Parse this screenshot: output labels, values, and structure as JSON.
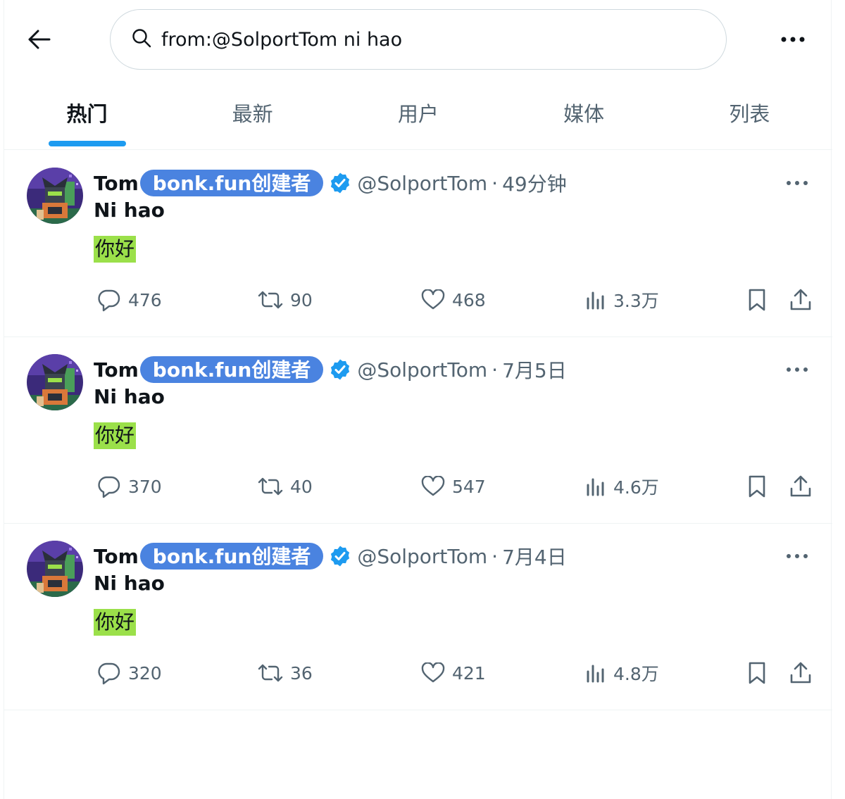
{
  "search": {
    "query": "from:@SolportTom ni hao"
  },
  "tabs": [
    {
      "label": "热门",
      "active": true
    },
    {
      "label": "最新"
    },
    {
      "label": "用户"
    },
    {
      "label": "媒体"
    },
    {
      "label": "列表"
    }
  ],
  "posts": [
    {
      "name": "Tom",
      "badge": "bonk.fun创建者",
      "handle": "@SolportTom",
      "sep": "·",
      "time": "49分钟",
      "title": "Ni hao",
      "body": "你好",
      "replies": "476",
      "reposts": "90",
      "likes": "468",
      "views": "3.3万"
    },
    {
      "name": "Tom",
      "badge": "bonk.fun创建者",
      "handle": "@SolportTom",
      "sep": "·",
      "time": "7月5日",
      "title": "Ni hao",
      "body": "你好",
      "replies": "370",
      "reposts": "40",
      "likes": "547",
      "views": "4.6万"
    },
    {
      "name": "Tom",
      "badge": "bonk.fun创建者",
      "handle": "@SolportTom",
      "sep": "·",
      "time": "7月4日",
      "title": "Ni hao",
      "body": "你好",
      "replies": "320",
      "reposts": "36",
      "likes": "421",
      "views": "4.8万"
    }
  ],
  "colors": {
    "accent": "#1d9bf0",
    "badge": "#4a83e0",
    "highlight": "#9be04a",
    "secondary_text": "#536471"
  },
  "icons": [
    "back-arrow-icon",
    "search-icon",
    "more-icon",
    "verified-icon",
    "reply-icon",
    "repost-icon",
    "like-icon",
    "views-icon",
    "bookmark-icon",
    "share-icon"
  ]
}
